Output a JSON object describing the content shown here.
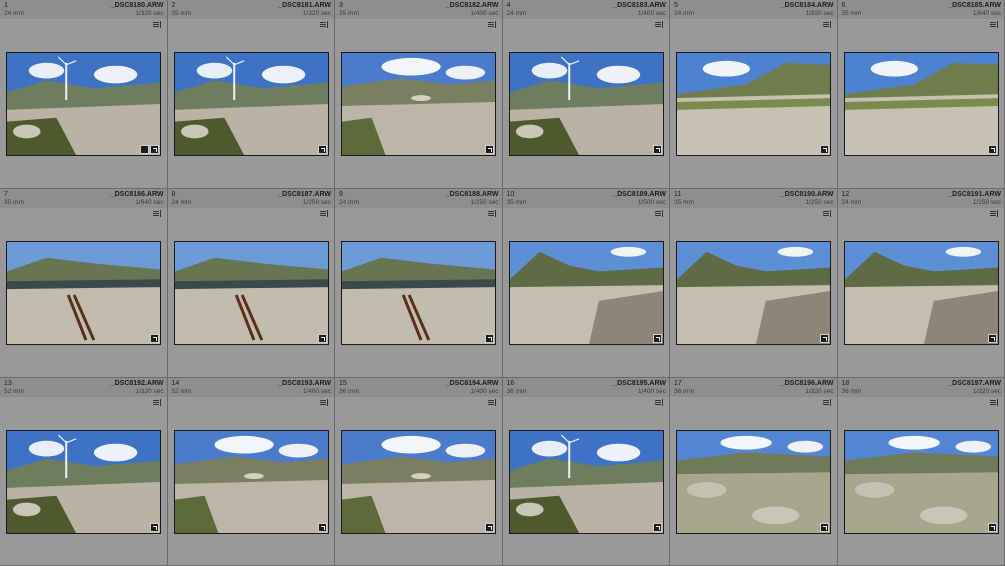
{
  "colors": {
    "cell_bg": "#999999",
    "grid_bg": "#5f5f5f",
    "header_bg": "#8e8e8e"
  },
  "photos": [
    {
      "index": "1",
      "filename": "_DSC8180.ARW",
      "focal": "24 mm",
      "shutter": "1/320 sec",
      "scene": "turbine-road",
      "extra_badge": true
    },
    {
      "index": "2",
      "filename": "_DSC8181.ARW",
      "focal": "35 mm",
      "shutter": "1/320 sec",
      "scene": "turbine-road"
    },
    {
      "index": "3",
      "filename": "_DSC8182.ARW",
      "focal": "35 mm",
      "shutter": "1/400 sec",
      "scene": "wide-road"
    },
    {
      "index": "4",
      "filename": "_DSC8183.ARW",
      "focal": "24 mm",
      "shutter": "1/400 sec",
      "scene": "turbine-road"
    },
    {
      "index": "5",
      "filename": "_DSC8184.ARW",
      "focal": "24 mm",
      "shutter": "1/320 sec",
      "scene": "hill-gravel"
    },
    {
      "index": "6",
      "filename": "_DSC8185.ARW",
      "focal": "35 mm",
      "shutter": "1/640 sec",
      "scene": "hill-gravel"
    },
    {
      "index": "7",
      "filename": "_DSC8186.ARW",
      "focal": "35 mm",
      "shutter": "1/640 sec",
      "scene": "rails"
    },
    {
      "index": "8",
      "filename": "_DSC8187.ARW",
      "focal": "24 mm",
      "shutter": "1/250 sec",
      "scene": "rails"
    },
    {
      "index": "9",
      "filename": "_DSC8188.ARW",
      "focal": "24 mm",
      "shutter": "1/250 sec",
      "scene": "rails"
    },
    {
      "index": "10",
      "filename": "_DSC8189.ARW",
      "focal": "35 mm",
      "shutter": "1/500 sec",
      "scene": "mountain-gravel"
    },
    {
      "index": "11",
      "filename": "_DSC8190.ARW",
      "focal": "35 mm",
      "shutter": "1/250 sec",
      "scene": "mountain-gravel"
    },
    {
      "index": "12",
      "filename": "_DSC8191.ARW",
      "focal": "24 mm",
      "shutter": "1/250 sec",
      "scene": "mountain-gravel"
    },
    {
      "index": "13",
      "filename": "_DSC8192.ARW",
      "focal": "52 mm",
      "shutter": "1/320 sec",
      "scene": "turbine-road"
    },
    {
      "index": "14",
      "filename": "_DSC8193.ARW",
      "focal": "52 mm",
      "shutter": "1/400 sec",
      "scene": "wide-road"
    },
    {
      "index": "15",
      "filename": "_DSC8194.ARW",
      "focal": "36 mm",
      "shutter": "1/400 sec",
      "scene": "wide-road"
    },
    {
      "index": "16",
      "filename": "_DSC8195.ARW",
      "focal": "36 mm",
      "shutter": "1/400 sec",
      "scene": "turbine-road"
    },
    {
      "index": "17",
      "filename": "_DSC8196.ARW",
      "focal": "36 mm",
      "shutter": "1/320 sec",
      "scene": "rocky-road"
    },
    {
      "index": "18",
      "filename": "_DSC8197.ARW",
      "focal": "36 mm",
      "shutter": "1/320 sec",
      "scene": "rocky-road"
    }
  ]
}
